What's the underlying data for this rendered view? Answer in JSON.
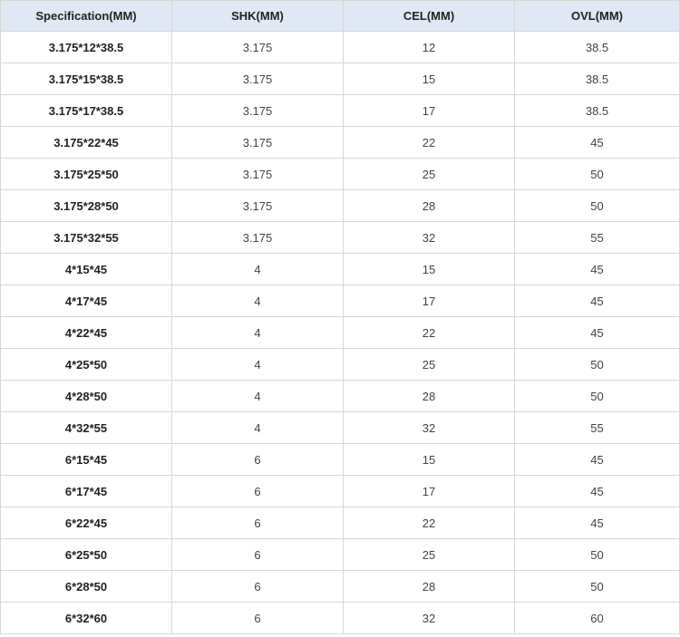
{
  "table": {
    "headers": [
      "Specification(MM)",
      "SHK(MM)",
      "CEL(MM)",
      "OVL(MM)"
    ],
    "rows": [
      [
        "3.175*12*38.5",
        "3.175",
        "12",
        "38.5"
      ],
      [
        "3.175*15*38.5",
        "3.175",
        "15",
        "38.5"
      ],
      [
        "3.175*17*38.5",
        "3.175",
        "17",
        "38.5"
      ],
      [
        "3.175*22*45",
        "3.175",
        "22",
        "45"
      ],
      [
        "3.175*25*50",
        "3.175",
        "25",
        "50"
      ],
      [
        "3.175*28*50",
        "3.175",
        "28",
        "50"
      ],
      [
        "3.175*32*55",
        "3.175",
        "32",
        "55"
      ],
      [
        "4*15*45",
        "4",
        "15",
        "45"
      ],
      [
        "4*17*45",
        "4",
        "17",
        "45"
      ],
      [
        "4*22*45",
        "4",
        "22",
        "45"
      ],
      [
        "4*25*50",
        "4",
        "25",
        "50"
      ],
      [
        "4*28*50",
        "4",
        "28",
        "50"
      ],
      [
        "4*32*55",
        "4",
        "32",
        "55"
      ],
      [
        "6*15*45",
        "6",
        "15",
        "45"
      ],
      [
        "6*17*45",
        "6",
        "17",
        "45"
      ],
      [
        "6*22*45",
        "6",
        "22",
        "45"
      ],
      [
        "6*25*50",
        "6",
        "25",
        "50"
      ],
      [
        "6*28*50",
        "6",
        "28",
        "50"
      ],
      [
        "6*32*60",
        "6",
        "32",
        "60"
      ]
    ],
    "colors": {
      "header_background": "#dfe8f4",
      "border": "#d7d7d7"
    }
  }
}
